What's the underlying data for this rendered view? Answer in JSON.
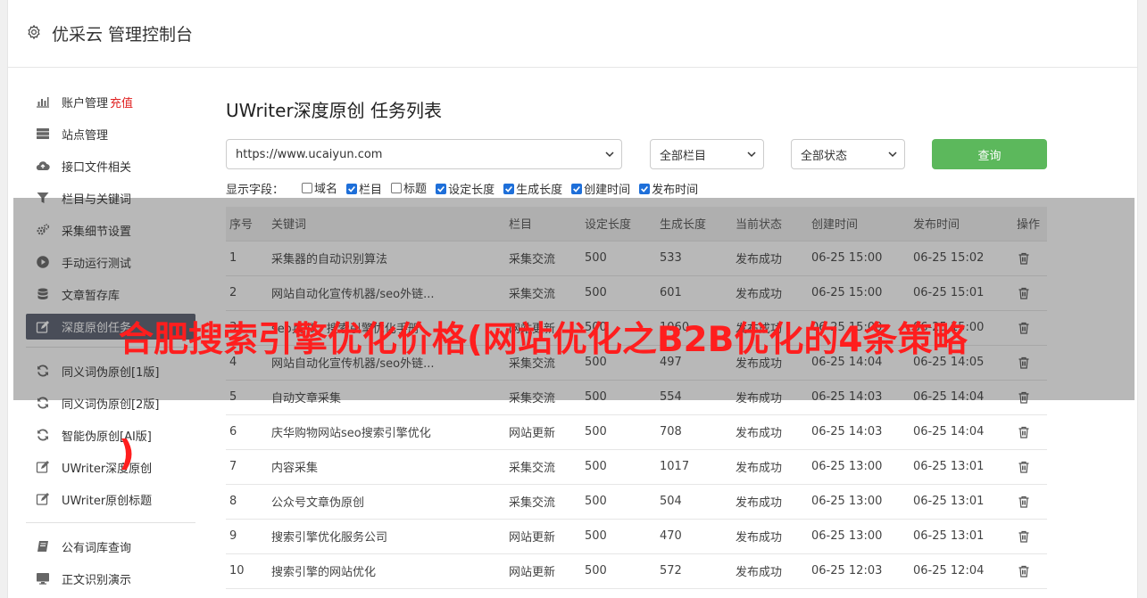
{
  "header": {
    "title": "优采云 管理控制台",
    "icon": "gear-icon"
  },
  "sidebar": {
    "group1": [
      {
        "label": "账户管理",
        "extra": "充值",
        "icon": "bar-chart-icon"
      },
      {
        "label": "站点管理",
        "icon": "server-icon"
      },
      {
        "label": "接口文件相关",
        "icon": "cloud-upload-icon"
      },
      {
        "label": "栏目与关键词",
        "icon": "filter-icon"
      },
      {
        "label": "采集细节设置",
        "icon": "cogs-icon"
      },
      {
        "label": "手动运行测试",
        "icon": "play-icon"
      },
      {
        "label": "文章暂存库",
        "icon": "database-icon"
      },
      {
        "label": "深度原创任务",
        "icon": "edit-icon",
        "active": true
      }
    ],
    "group2": [
      {
        "label": "同义词伪原创[1版]",
        "icon": "refresh-icon"
      },
      {
        "label": "同义词伪原创[2版]",
        "icon": "refresh-icon"
      },
      {
        "label": "智能伪原创[AI版]",
        "icon": "refresh-icon"
      },
      {
        "label": "UWriter深度原创",
        "icon": "edit-icon"
      },
      {
        "label": "UWriter原创标题",
        "icon": "edit-icon"
      }
    ],
    "group3": [
      {
        "label": "公有词库查询",
        "icon": "book-icon"
      },
      {
        "label": "正文识别演示",
        "icon": "monitor-icon"
      }
    ]
  },
  "main": {
    "title": "UWriter深度原创 任务列表",
    "site_select": "https://www.ucaiyun.com",
    "column_select": "全部栏目",
    "status_select": "全部状态",
    "query_button": "查询",
    "fields_label": "显示字段：",
    "fields": [
      {
        "label": "域名",
        "checked": false
      },
      {
        "label": "栏目",
        "checked": true
      },
      {
        "label": "标题",
        "checked": false
      },
      {
        "label": "设定长度",
        "checked": true
      },
      {
        "label": "生成长度",
        "checked": true
      },
      {
        "label": "创建时间",
        "checked": true
      },
      {
        "label": "发布时间",
        "checked": true
      }
    ],
    "table": {
      "headers": [
        "序号",
        "关键词",
        "栏目",
        "设定长度",
        "生成长度",
        "当前状态",
        "创建时间",
        "发布时间",
        "操作"
      ],
      "rows": [
        [
          "1",
          "采集器的自动识别算法",
          "采集交流",
          "500",
          "533",
          "发布成功",
          "06-25 15:00",
          "06-25 15:02"
        ],
        [
          "2",
          "网站自动化宣传机器/seo外链...",
          "采集交流",
          "500",
          "601",
          "发布成功",
          "06-25 15:00",
          "06-25 15:01"
        ],
        [
          "3",
          "seo兵书：搜索引擎优化手册",
          "网站更新",
          "500",
          "1060",
          "发布成功",
          "06-25 15:00",
          "06-25 15:00"
        ],
        [
          "4",
          "网站自动化宣传机器/seo外链...",
          "采集交流",
          "500",
          "497",
          "发布成功",
          "06-25 14:04",
          "06-25 14:05"
        ],
        [
          "5",
          "自动文章采集",
          "采集交流",
          "500",
          "554",
          "发布成功",
          "06-25 14:03",
          "06-25 14:04"
        ],
        [
          "6",
          "庆华购物网站seo搜索引擎优化",
          "网站更新",
          "500",
          "708",
          "发布成功",
          "06-25 14:03",
          "06-25 14:04"
        ],
        [
          "7",
          "内容采集",
          "采集交流",
          "500",
          "1017",
          "发布成功",
          "06-25 13:00",
          "06-25 13:01"
        ],
        [
          "8",
          "公众号文章伪原创",
          "采集交流",
          "500",
          "504",
          "发布成功",
          "06-25 13:00",
          "06-25 13:01"
        ],
        [
          "9",
          "搜索引擎优化服务公司",
          "网站更新",
          "500",
          "470",
          "发布成功",
          "06-25 13:00",
          "06-25 13:01"
        ],
        [
          "10",
          "搜索引擎的网站优化",
          "网站更新",
          "500",
          "572",
          "发布成功",
          "06-25 12:03",
          "06-25 12:04"
        ]
      ]
    }
  },
  "overlay": {
    "watermark_line1": "合肥搜索引擎优化价格(网站优化之B2B优化的4条策略",
    "watermark_line2": ")"
  },
  "colors": {
    "accent_green": "#5cb85c",
    "active_nav": "#5a6071",
    "status_ok": "#2e8b2e",
    "recharge": "#e02020",
    "watermark": "#ff1e1e"
  }
}
